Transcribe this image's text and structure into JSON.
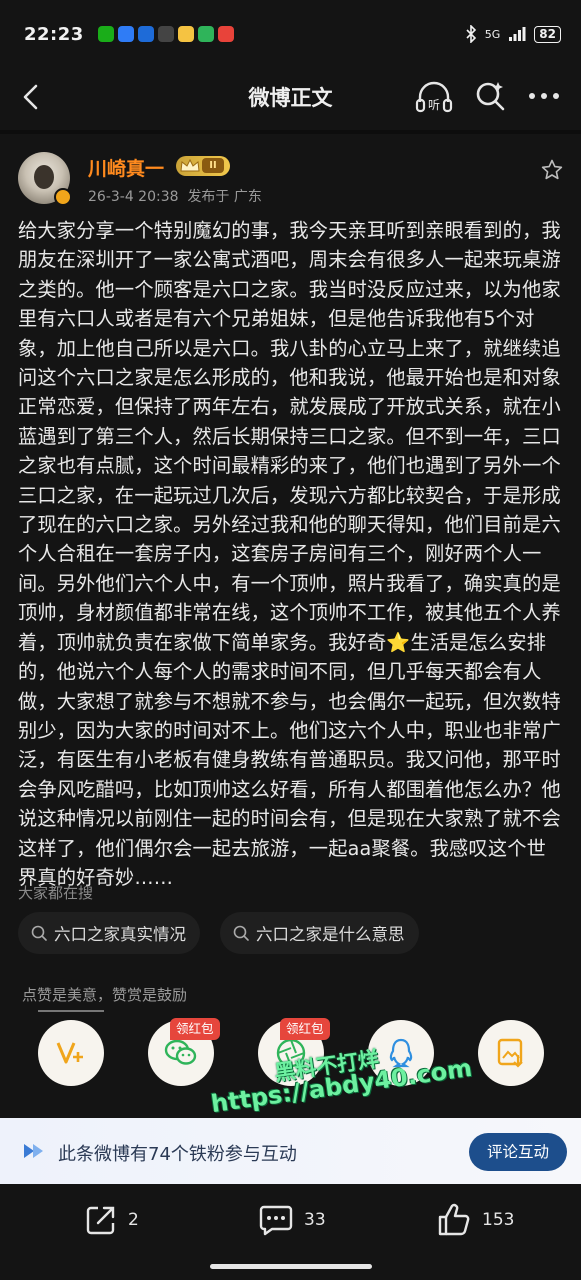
{
  "status_bar": {
    "time": "22:23",
    "network": "5G",
    "battery": "82",
    "app_icon_colors": [
      "#1aad19",
      "#2f7cf6",
      "#1e6bd8",
      "#444444",
      "#f5c342",
      "#2fb45a",
      "#e8433a"
    ]
  },
  "nav": {
    "title": "微博正文",
    "listen_label": "听"
  },
  "author": {
    "name": "川崎真一",
    "vip_level": "II",
    "date": "26-3-4 20:38",
    "location": "发布于 广东"
  },
  "post": {
    "text": "给大家分享一个特别魔幻的事，我今天亲耳听到亲眼看到的，我朋友在深圳开了一家公寓式酒吧，周末会有很多人一起来玩桌游之类的。他一个顾客是六口之家。我当时没反应过来，以为他家里有六口人或者是有六个兄弟姐妹，但是他告诉我他有5个对象，加上他自己所以是六口。我八卦的心立马上来了，就继续追问这个六口之家是怎么形成的，他和我说，他最开始也是和对象正常恋爱，但保持了两年左右，就发展成了开放式关系，就在小蓝遇到了第三个人，然后长期保持三口之家。但不到一年，三口之家也有点腻，这个时间最精彩的来了，他们也遇到了另外一个三口之家，在一起玩过几次后，发现六方都比较契合，于是形成了现在的六口之家。另外经过我和他的聊天得知，他们目前是六个人合租在一套房子内，这套房子房间有三个，刚好两个人一间。另外他们六个人中，有一个顶帅，照片我看了，确实真的是顶帅，身材颜值都非常在线，这个顶帅不工作，被其他五个人养着，顶帅就负责在家做下简单家务。我好奇⭐生活是怎么安排的，他说六个人每个人的需求时间不同，但几乎每天都会有人做，大家想了就参与不想就不参与，也会偶尔一起玩，但次数特别少，因为大家的时间对不上。他们这六个人中，职业也非常广泛，有医生有小老板有健身教练有普通职员。我又问他，那平时会争风吃醋吗，比如顶帅这么好看，所有人都围着他怎么办？他说这种情况以前刚住一起的时间会有，但是现在大家熟了就不会这样了，他们偶尔会一起去旅游，一起aa聚餐。我感叹这个世界真的好奇妙……"
  },
  "search": {
    "title": "大家都在搜",
    "chips": [
      "六口之家真实情况",
      "六口之家是什么意思"
    ]
  },
  "reward": {
    "tip": "点赞是美意，赞赏是鼓励",
    "red_packet_tags": [
      "领红包",
      "领红包"
    ]
  },
  "watermark": {
    "line1": "黑料不打烊",
    "line2": "https://abdy40.com"
  },
  "fan_bar": {
    "text": "此条微博有74个铁粉参与互动",
    "button": "评论互动"
  },
  "bottom": {
    "repost_count": "2",
    "comment_count": "33",
    "like_count": "153"
  },
  "colors": {
    "background": "#141414",
    "author_name": "#ff8a1e",
    "red_tag": "#e6463c",
    "fan_button": "#1d4e8c",
    "watermark": "#6df0a0"
  }
}
